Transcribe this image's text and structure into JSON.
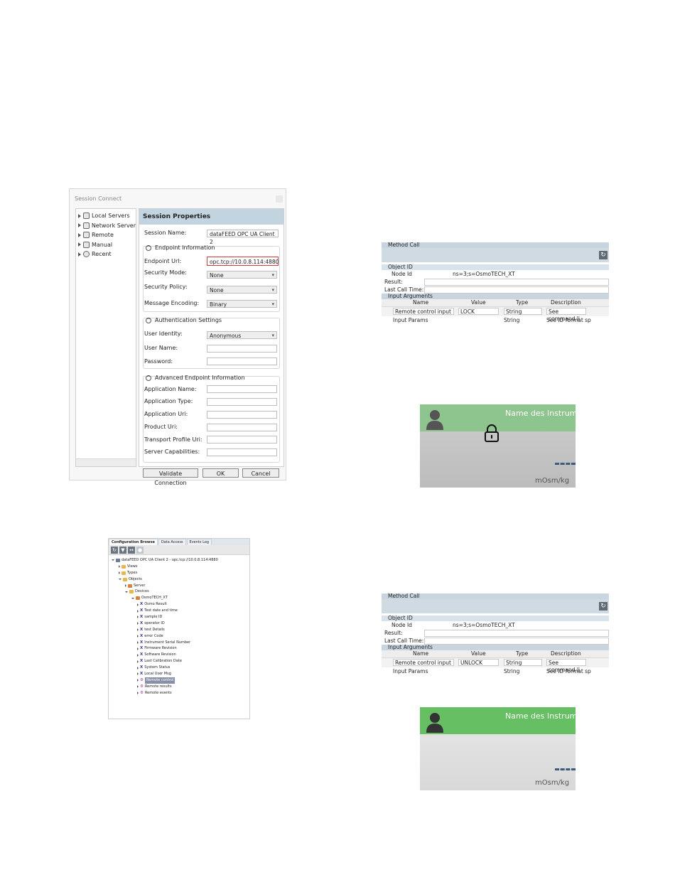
{
  "session_connect": {
    "window_title": "Session Connect",
    "tree": [
      "Local Servers",
      "Network Server",
      "Remote",
      "Manual",
      "Recent"
    ],
    "panel_title": "Session Properties",
    "session_name_label": "Session Name:",
    "session_name_value": "dataFEED OPC UA Client 2",
    "endpoint_section": "Endpoint Information",
    "endpoint_url_label": "Endpoint Url:",
    "endpoint_url_value": "opc.tcp://10.0.8.114:4880",
    "security_mode_label": "Security Mode:",
    "security_mode_value": "None",
    "security_policy_label": "Security Policy:",
    "security_policy_value": "None",
    "message_encoding_label": "Message Encoding:",
    "message_encoding_value": "Binary",
    "auth_section": "Authentication Settings",
    "user_identity_label": "User Identity:",
    "user_identity_value": "Anonymous",
    "user_name_label": "User Name:",
    "password_label": "Password:",
    "advanced_section": "Advanced Endpoint Information",
    "advanced_fields": [
      "Application Name:",
      "Application Type:",
      "Application Uri:",
      "Product Uri:",
      "Transport Profile Uri:",
      "Server Capabilities:"
    ],
    "validate_label": "Validate Connection",
    "ok_label": "OK",
    "cancel_label": "Cancel"
  },
  "method_call_1": {
    "title": "Method Call",
    "object_id": "Object ID",
    "node_id_label": "Node Id",
    "node_id_value": "ns=3;s=OsmoTECH_XT",
    "result_label": "Result:",
    "last_call_label": "Last Call Time:",
    "input_args": "Input Arguments",
    "headers": [
      "Name",
      "Value",
      "Type",
      "Description"
    ],
    "row1": [
      "Remote control input",
      "LOCK",
      "String",
      "See command li"
    ],
    "row2": [
      "Input Params",
      "",
      "String",
      "See ID format sp"
    ]
  },
  "method_call_2": {
    "title": "Method Call",
    "object_id": "Object ID",
    "node_id_label": "Node Id",
    "node_id_value": "ns=3;s=OsmoTECH_XT",
    "result_label": "Result:",
    "last_call_label": "Last Call Time:",
    "input_args": "Input Arguments",
    "headers": [
      "Name",
      "Value",
      "Type",
      "Description"
    ],
    "row1": [
      "Remote control input",
      "UNLOCK",
      "String",
      "See command li"
    ],
    "row2": [
      "Input Params",
      "",
      "String",
      "See ID format sp"
    ]
  },
  "instrument_1": {
    "name": "Name des Instrumen",
    "unit": "mOsm/kg"
  },
  "instrument_2": {
    "name": "Name des Instrumen",
    "unit": "mOsm/kg"
  },
  "config_browser": {
    "tabs": [
      "Configuration Browse",
      "Data Access",
      "Events Log"
    ],
    "root": "dataFEED OPC UA Client 2 - opc.tcp://10.0.8.114:4880",
    "items": [
      "Views",
      "Types",
      "Objects",
      "Server",
      "Devices",
      "OsmoTECH_XT",
      "Osmo Result",
      "Test date and time",
      "sample ID",
      "operator ID",
      "test Details",
      "error Code",
      "Instrument Serial Number",
      "Firmware Revision",
      "Software Revision",
      "Last Calibration Date",
      "System Status",
      "Local User Msg",
      "Remote control",
      "Remote results",
      "Remote events"
    ]
  }
}
